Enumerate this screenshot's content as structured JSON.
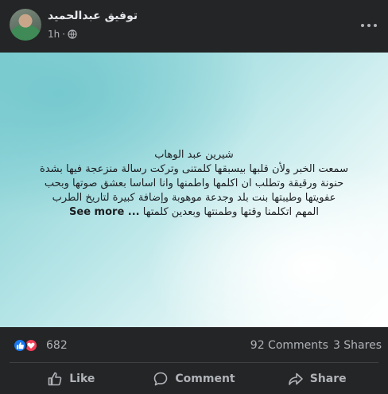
{
  "post": {
    "author": "توفيق عبدالحميد",
    "time": "1h",
    "separator": "·",
    "lines": [
      "شيرين عبد الوهاب",
      "سمعت الخبر ولأن قلبها بيسبقها كلمتنى وتركت رسالة منزعجة فيها بشدة",
      "حنونة ورقيقة وتطلب ان اكلمها واطمنها وانا اساسا بعشق صوتها وبحب",
      "عفويتها وطيبتها بنت بلد وجدعة موهوبة وإضافة كبيرة لتاريخ الطرب",
      "المهم اتكلمنا وقتها وطمنتها وبعدين كلمتها"
    ],
    "see_more": "See more ...",
    "background_colors": [
      "#7fcdd1",
      "#ffffff"
    ]
  },
  "stats": {
    "reactions_count": "682",
    "comments": "92 Comments",
    "shares": "3 Shares",
    "reaction_icons": [
      "like-icon",
      "love-icon"
    ]
  },
  "actions": {
    "like": "Like",
    "comment": "Comment",
    "share": "Share"
  },
  "colors": {
    "like": "#1877f2",
    "love": "#f33e58",
    "surface": "#242526"
  }
}
